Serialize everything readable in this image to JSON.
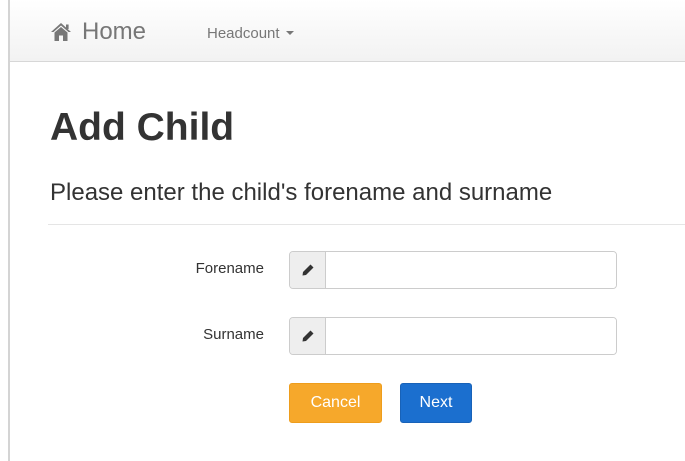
{
  "navbar": {
    "brand_label": "Home",
    "brand_icon": "home-icon",
    "dropdown_label": "Headcount"
  },
  "page": {
    "title": "Add Child",
    "subtitle": "Please enter the child's forename and surname"
  },
  "form": {
    "forename": {
      "label": "Forename",
      "value": "",
      "icon": "pencil-icon"
    },
    "surname": {
      "label": "Surname",
      "value": "",
      "icon": "pencil-icon"
    }
  },
  "actions": {
    "cancel_label": "Cancel",
    "next_label": "Next"
  },
  "colors": {
    "cancel": "#f6a82b",
    "next": "#1b6fcf",
    "navbar": "#f5f5f5"
  }
}
